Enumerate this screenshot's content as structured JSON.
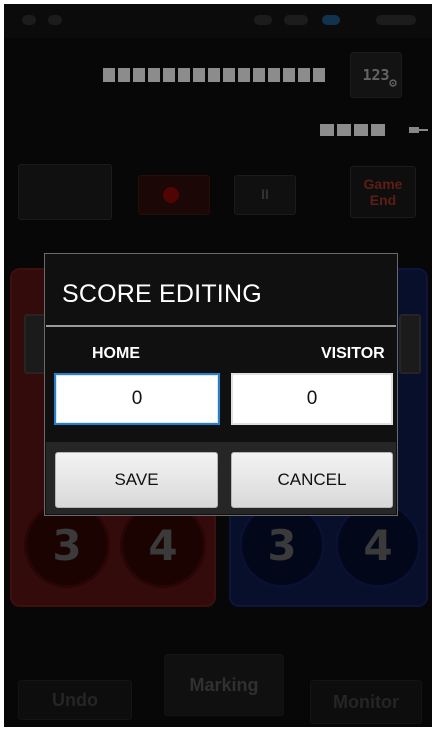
{
  "colors": {
    "home_panel": "#4d1110",
    "visitor_panel": "#0c1742",
    "record_red": "#7d0707",
    "game_end_text": "#8f2d1f",
    "focus_blue": "#2c7fc7"
  },
  "background": {
    "settings_button": {
      "label": "123",
      "icon": "gear-icon"
    },
    "control_row": {
      "game_end_label": [
        "Game",
        "End"
      ],
      "pause_glyph": "II"
    },
    "home_buttons": [
      "3",
      "4"
    ],
    "visitor_buttons": [
      "3",
      "4"
    ],
    "bottom_bar": {
      "undo": "Undo",
      "marking": "Marking",
      "monitor": "Monitor"
    }
  },
  "dialog": {
    "title": "SCORE EDITING",
    "home_label": "HOME",
    "visitor_label": "VISITOR",
    "home_score": "0",
    "visitor_score": "0",
    "save_label": "SAVE",
    "cancel_label": "CANCEL"
  }
}
